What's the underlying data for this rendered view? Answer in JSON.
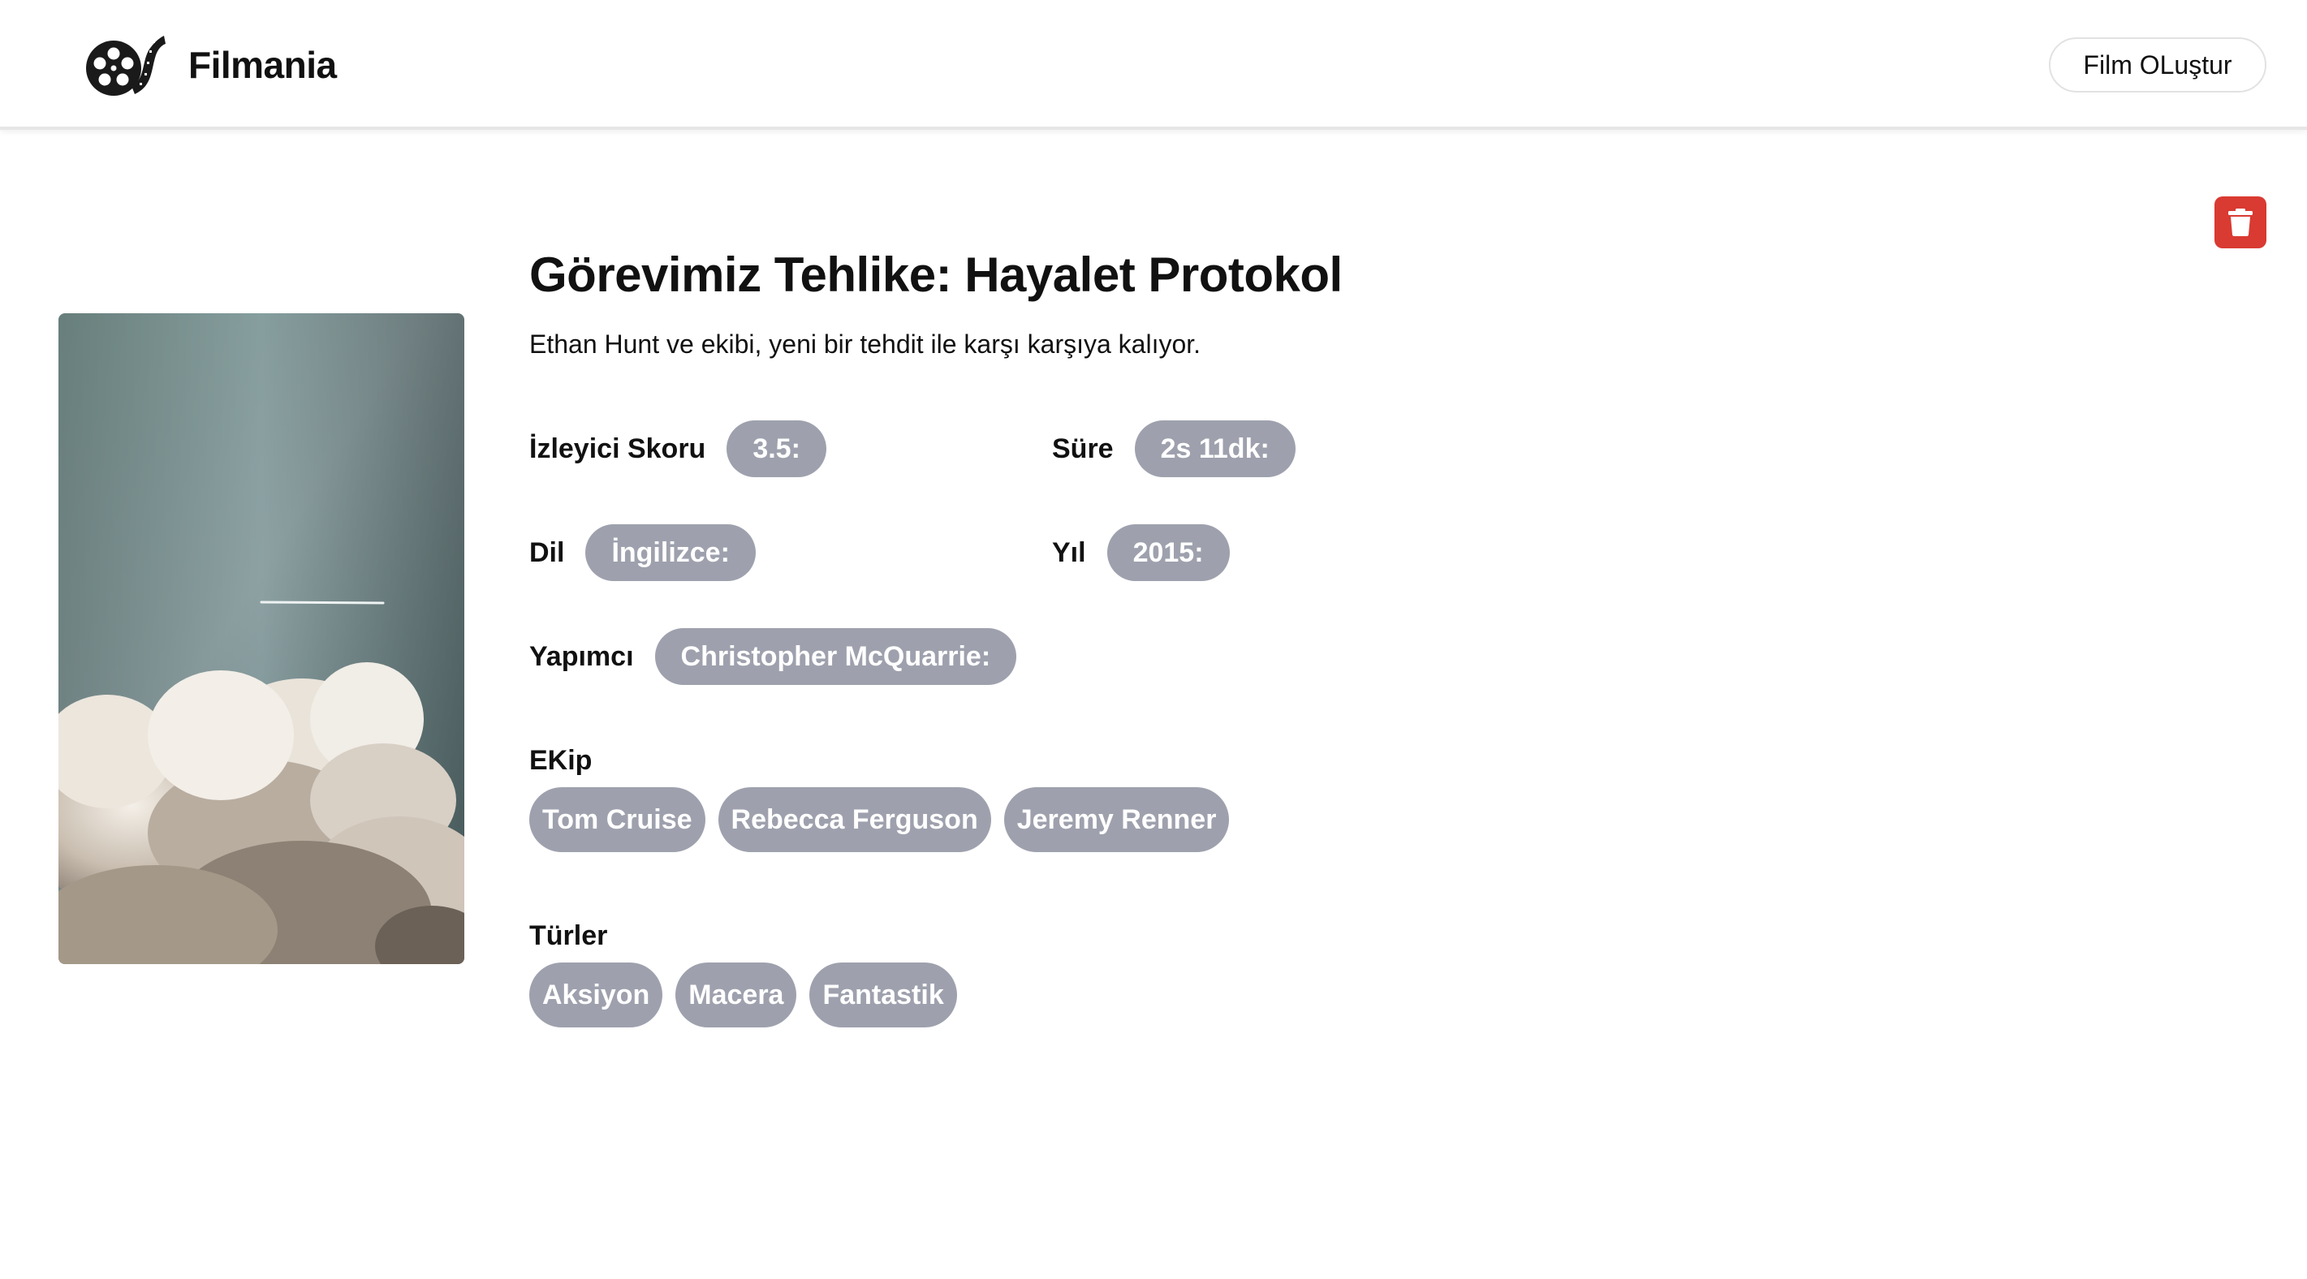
{
  "header": {
    "brand_name": "Filmania",
    "logo_icon": "film-reel-icon",
    "create_button_label": "Film OLuştur"
  },
  "actions": {
    "delete_icon": "trash-icon",
    "delete_color": "#d93a32"
  },
  "movie": {
    "title": "Görevimiz Tehlike: Hayalet Protokol",
    "description": "Ethan Hunt ve ekibi, yeni bir tehdit ile karşı karşıya kalıyor.",
    "score_label": "İzleyici Skoru",
    "score_value": "3.5:",
    "duration_label": "Süre",
    "duration_value": "2s 11dk:",
    "language_label": "Dil",
    "language_value": "İngilizce:",
    "year_label": "Yıl",
    "year_value": "2015:",
    "producer_label": "Yapımcı",
    "producer_value": "Christopher McQuarrie:",
    "cast_label": "EKip",
    "cast": [
      "Tom Cruise",
      "Rebecca Ferguson",
      "Jeremy Renner"
    ],
    "genres_label": "Türler",
    "genres": [
      "Aksiyon",
      "Macera",
      "Fantastik"
    ]
  },
  "colors": {
    "pill_bg": "#9ea1ad",
    "pill_text": "#ffffff"
  }
}
